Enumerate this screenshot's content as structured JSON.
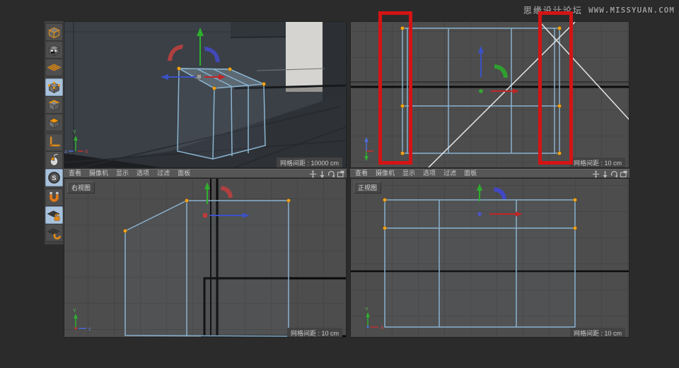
{
  "watermark": {
    "site_name": "思缘设计论坛",
    "site_url": "WWW.MISSYUAN.COM"
  },
  "sidebar": {
    "snap_letter": "S",
    "tools": [
      {
        "id": "model-mode",
        "icon": "cube-outline-icon",
        "active": false
      },
      {
        "id": "texture-mode",
        "icon": "cube-checker-icon",
        "active": false
      },
      {
        "id": "workplane-mode",
        "icon": "grid-plane-icon",
        "active": false
      },
      {
        "id": "points-mode",
        "icon": "cube-points-icon",
        "active": true
      },
      {
        "id": "edges-mode",
        "icon": "cube-edges-icon",
        "active": false
      },
      {
        "id": "polygons-mode",
        "icon": "cube-polygon-icon",
        "active": false
      },
      {
        "id": "enable-axis",
        "icon": "axis-icon",
        "active": false
      },
      {
        "id": "viewport-solo",
        "icon": "mouse-icon",
        "active": false
      },
      {
        "id": "enable-snap",
        "icon": "snap-s-icon",
        "active": true
      },
      {
        "id": "snap-magnet",
        "icon": "magnet-icon",
        "active": false
      },
      {
        "id": "lock-workplane",
        "icon": "plane-lock-icon",
        "active": true
      },
      {
        "id": "snap-workplane",
        "icon": "plane-magnet-icon",
        "active": false
      }
    ]
  },
  "viewport_menu": {
    "items": [
      "查看",
      "摄像机",
      "显示",
      "选项",
      "过滤",
      "面板"
    ]
  },
  "viewports": {
    "perspective": {
      "grid_label": "网格间距 : 10000 cm",
      "axis": {
        "y": "Y",
        "x": "X",
        "z": "z"
      }
    },
    "top": {
      "grid_label": "网格间距 : 10 cm"
    },
    "right": {
      "title": "右视图",
      "grid_label": "网格间距 : 10 cm",
      "axis": {
        "y": "Y",
        "z": "z"
      }
    },
    "front": {
      "title": "正视图",
      "grid_label": "网格间距 : 10 cm",
      "axis": {
        "y": "Y",
        "x": "X"
      }
    }
  },
  "colors": {
    "wireframe": "#89b2cf",
    "selected_point": "#f5a31d",
    "annotation_red": "#d41414",
    "axis_x_red": "#c22525",
    "axis_y_green": "#2fae2f",
    "axis_z_blue": "#3b52c9",
    "tool_active_bg": "#a9c2dc"
  }
}
